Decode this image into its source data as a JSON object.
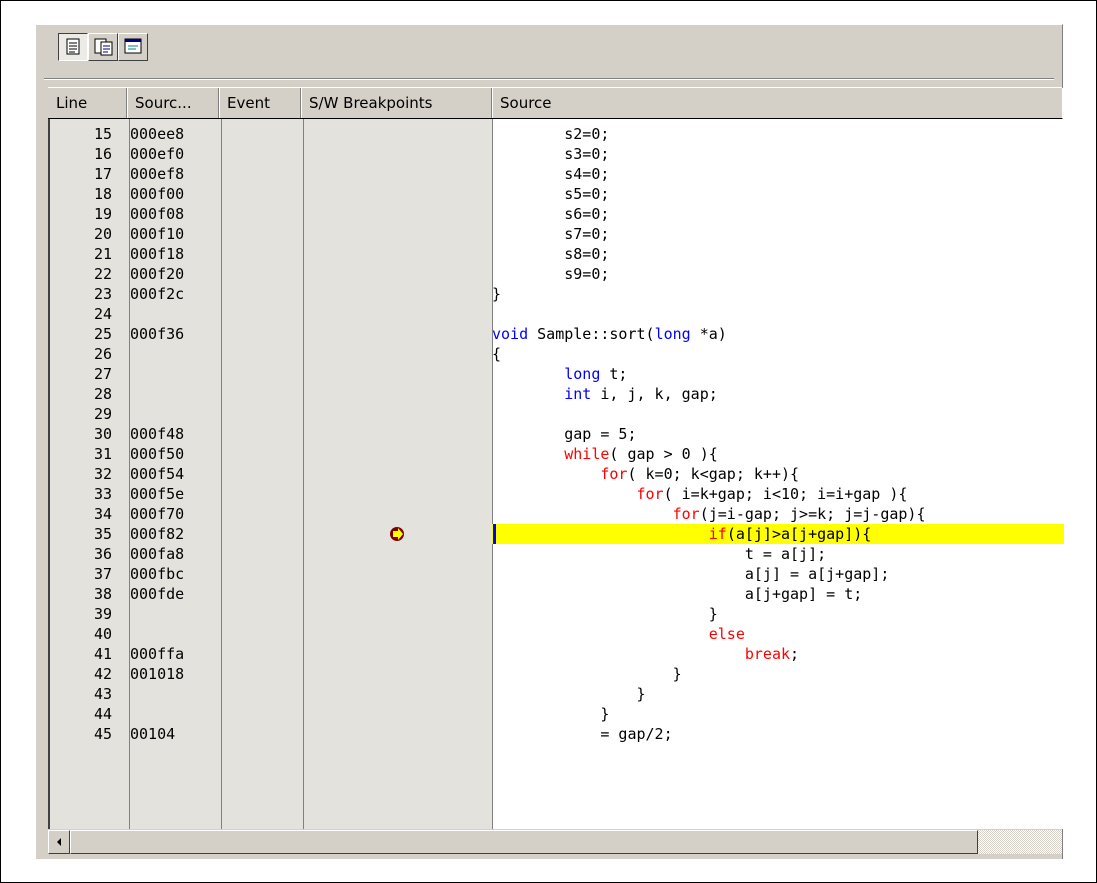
{
  "toolbar": {
    "buttons": [
      {
        "icon": "source-view-icon",
        "pressed": true
      },
      {
        "icon": "mixed-view-icon",
        "pressed": false
      },
      {
        "icon": "disassembly-view-icon",
        "pressed": false
      }
    ]
  },
  "columns": {
    "line": "Line",
    "source_address": "Sourc...",
    "event": "Event",
    "sw_breakpoints": "S/W Breakpoints",
    "source": "Source"
  },
  "pc_icon": "program-counter-arrow-icon",
  "highlight_color": "#ffff00",
  "keyword_color": "#0000ff",
  "control_keyword_color": "#ff0000",
  "current_line": "35",
  "rows": [
    {
      "line": "15",
      "addr": "000ee8",
      "pre": "        s2=0;"
    },
    {
      "line": "16",
      "addr": "000ef0",
      "pre": "        s3=0;"
    },
    {
      "line": "17",
      "addr": "000ef8",
      "pre": "        s4=0;"
    },
    {
      "line": "18",
      "addr": "000f00",
      "pre": "        s5=0;"
    },
    {
      "line": "19",
      "addr": "000f08",
      "pre": "        s6=0;"
    },
    {
      "line": "20",
      "addr": "000f10",
      "pre": "        s7=0;"
    },
    {
      "line": "21",
      "addr": "000f18",
      "pre": "        s8=0;"
    },
    {
      "line": "22",
      "addr": "000f20",
      "pre": "        s9=0;"
    },
    {
      "line": "23",
      "addr": "000f2c",
      "pre": "}"
    },
    {
      "line": "24",
      "addr": "",
      "pre": ""
    },
    {
      "line": "25",
      "addr": "000f36",
      "pre": "",
      "kw": "void",
      "post": " Sample::sort(",
      "kw_b": "long",
      "post_b": " *a)"
    },
    {
      "line": "26",
      "addr": "",
      "pre": "{"
    },
    {
      "line": "27",
      "addr": "",
      "pre": "        ",
      "kw": "long",
      "post": " t;"
    },
    {
      "line": "28",
      "addr": "",
      "pre": "        ",
      "kw": "int",
      "post": " i, j, k, gap;"
    },
    {
      "line": "29",
      "addr": "",
      "pre": ""
    },
    {
      "line": "30",
      "addr": "000f48",
      "pre": "        gap = 5;"
    },
    {
      "line": "31",
      "addr": "000f50",
      "pre": "        ",
      "kw2": "while",
      "post": "( gap > 0 ){"
    },
    {
      "line": "32",
      "addr": "000f54",
      "pre": "            ",
      "kw2": "for",
      "post": "( k=0; k<gap; k++){"
    },
    {
      "line": "33",
      "addr": "000f5e",
      "pre": "                ",
      "kw2": "for",
      "post": "( i=k+gap; i<10; i=i+gap ){"
    },
    {
      "line": "34",
      "addr": "000f70",
      "pre": "                    ",
      "kw2": "for",
      "post": "(j=i-gap; j>=k; j=j-gap){"
    },
    {
      "line": "35",
      "addr": "000f82",
      "pre": "                        ",
      "kw2": "if",
      "post": "(a[j]>a[j+gap]){"
    },
    {
      "line": "36",
      "addr": "000fa8",
      "pre": "                            t = a[j];"
    },
    {
      "line": "37",
      "addr": "000fbc",
      "pre": "                            a[j] = a[j+gap];"
    },
    {
      "line": "38",
      "addr": "000fde",
      "pre": "                            a[j+gap] = t;"
    },
    {
      "line": "39",
      "addr": "",
      "pre": "                        }"
    },
    {
      "line": "40",
      "addr": "",
      "pre": "                        ",
      "kw2": "else"
    },
    {
      "line": "41",
      "addr": "000ffa",
      "pre": "                            ",
      "kw2": "break",
      "post": ";"
    },
    {
      "line": "42",
      "addr": "001018",
      "pre": "                    }"
    },
    {
      "line": "43",
      "addr": "",
      "pre": "                }"
    },
    {
      "line": "44",
      "addr": "",
      "pre": "            }"
    },
    {
      "line": "45",
      "addr": "00104",
      "pre": "            = gap/2;"
    }
  ],
  "scrollbar": {
    "left_arrow_icon": "scroll-left-arrow-icon"
  }
}
